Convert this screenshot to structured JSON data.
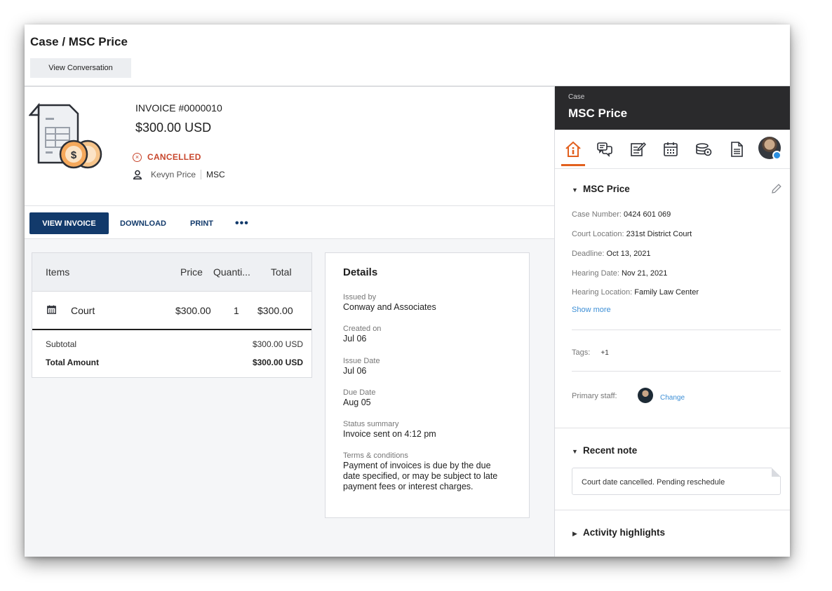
{
  "header": {
    "title": "Case / MSC Price",
    "view_conversation": "View Conversation"
  },
  "invoice": {
    "number": "INVOICE #0000010",
    "amount": "$300.00 USD",
    "status": "CANCELLED",
    "client_name": "Kevyn Price",
    "client_org": "MSC"
  },
  "actions": {
    "view_invoice": "VIEW INVOICE",
    "download": "DOWNLOAD",
    "print": "PRINT",
    "more": "•••"
  },
  "items": {
    "columns": [
      "Items",
      "Price",
      "Quanti...",
      "Total"
    ],
    "rows": [
      {
        "name": "Court",
        "price": "$300.00",
        "quantity": "1",
        "total": "$300.00"
      }
    ],
    "subtotal_label": "Subtotal",
    "subtotal_value": "$300.00 USD",
    "total_label": "Total Amount",
    "total_value": "$300.00 USD"
  },
  "details": {
    "title": "Details",
    "fields": [
      {
        "label": "Issued by",
        "value": "Conway and Associates"
      },
      {
        "label": "Created on",
        "value": "Jul 06"
      },
      {
        "label": "Issue Date",
        "value": "Jul 06"
      },
      {
        "label": "Due Date",
        "value": "Aug 05"
      },
      {
        "label": "Status summary",
        "value": "Invoice sent on 4:12 pm"
      },
      {
        "label": "Terms & conditions",
        "value": "Payment of invoices is due by the due date specified, or may be subject to late payment fees or interest charges."
      }
    ]
  },
  "panel": {
    "kicker": "Case",
    "title": "MSC Price",
    "tabs": [
      "home-icon",
      "chat-icon",
      "edit-note-icon",
      "calendar-icon",
      "billing-icon",
      "document-icon",
      "user-avatar"
    ],
    "case_section": {
      "title": "MSC Price",
      "fields": [
        {
          "label": "Case Number:",
          "value": "0424 601 069"
        },
        {
          "label": "Court Location:",
          "value": "231st District Court"
        },
        {
          "label": "Deadline:",
          "value": "Oct 13, 2021"
        },
        {
          "label": "Hearing Date:",
          "value": "Nov 21, 2021"
        },
        {
          "label": "Hearing Location:",
          "value": "Family Law Center"
        }
      ],
      "show_more": "Show more"
    },
    "tags_label": "Tags:",
    "tags_count": "+1",
    "primary_staff_label": "Primary staff:",
    "change_label": "Change",
    "recent_note_title": "Recent note",
    "recent_note_text": "Court date cancelled. Pending reschedule",
    "activity_title": "Activity highlights"
  },
  "colors": {
    "primary": "#123a6b",
    "status_cancelled": "#c8472d",
    "active_tab": "#e2601e",
    "link": "#3d8fd6",
    "panel_header": "#2a2a2c"
  }
}
